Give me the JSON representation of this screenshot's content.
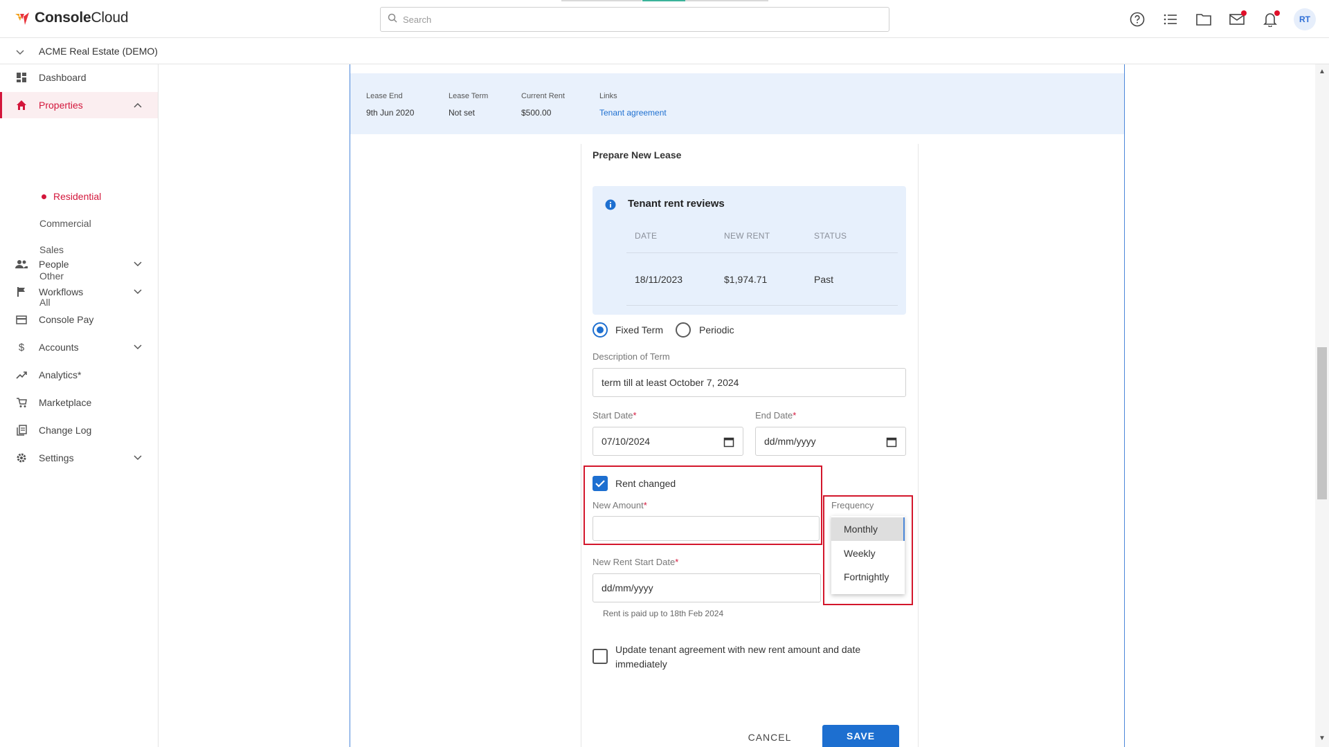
{
  "app": {
    "brand_a": "Console",
    "brand_b": "Cloud"
  },
  "search": {
    "placeholder": "Search"
  },
  "user": {
    "initials": "RT"
  },
  "org": {
    "name": "ACME Real Estate (DEMO)"
  },
  "sidebar": {
    "items": [
      {
        "label": "Dashboard",
        "icon": "dashboard-icon"
      },
      {
        "label": "Properties",
        "icon": "home-icon"
      },
      {
        "label": "People",
        "icon": "people-icon"
      },
      {
        "label": "Workflows",
        "icon": "flag-icon"
      },
      {
        "label": "Console Pay",
        "icon": "card-icon"
      },
      {
        "label": "Accounts",
        "icon": "dollar-icon"
      },
      {
        "label": "Analytics*",
        "icon": "trend-icon"
      },
      {
        "label": "Marketplace",
        "icon": "cart-icon"
      },
      {
        "label": "Change Log",
        "icon": "log-icon"
      },
      {
        "label": "Settings",
        "icon": "gear-icon"
      }
    ],
    "properties_sub": [
      "Residential",
      "Commercial",
      "Sales",
      "Other",
      "All"
    ]
  },
  "lease": {
    "end_label": "Lease End",
    "end_value": "9th Jun 2020",
    "term_label": "Lease Term",
    "term_value": "Not set",
    "rent_label": "Current Rent",
    "rent_value": "$500.00",
    "links_label": "Links",
    "links_value": "Tenant agreement"
  },
  "form": {
    "title": "Prepare New Lease",
    "reviews": {
      "title": "Tenant rent reviews",
      "headers": [
        "DATE",
        "NEW RENT",
        "STATUS"
      ],
      "rows": [
        [
          "18/11/2023",
          "$1,974.71",
          "Past"
        ]
      ]
    },
    "term_type": {
      "fixed": "Fixed Term",
      "periodic": "Periodic",
      "selected": "Fixed Term"
    },
    "description_label": "Description of Term",
    "description_value": "term till at least October 7, 2024",
    "start_label": "Start Date",
    "start_value": "07/10/2024",
    "end_label": "End Date",
    "end_value": "dd/mm/yyyy",
    "rent_changed_label": "Rent changed",
    "rent_changed": true,
    "new_amount_label": "New Amount",
    "new_amount_value": "",
    "frequency_label": "Frequency",
    "frequency_options": [
      "Monthly",
      "Weekly",
      "Fortnightly"
    ],
    "frequency_selected": "Monthly",
    "new_rent_start_label": "New Rent Start Date",
    "new_rent_start_value": "dd/mm/yyyy",
    "paid_note": "Rent is paid up to 18th Feb 2024",
    "update_agreement_label_1": "Update tenant agreement with new rent amount and date",
    "update_agreement_label_2": "immediately",
    "update_agreement": false,
    "cancel_label": "CANCEL",
    "save_label": "SAVE"
  },
  "colors": {
    "accent": "#d3163b",
    "primary": "#1d6fd0",
    "highlight": "#d3162b"
  }
}
